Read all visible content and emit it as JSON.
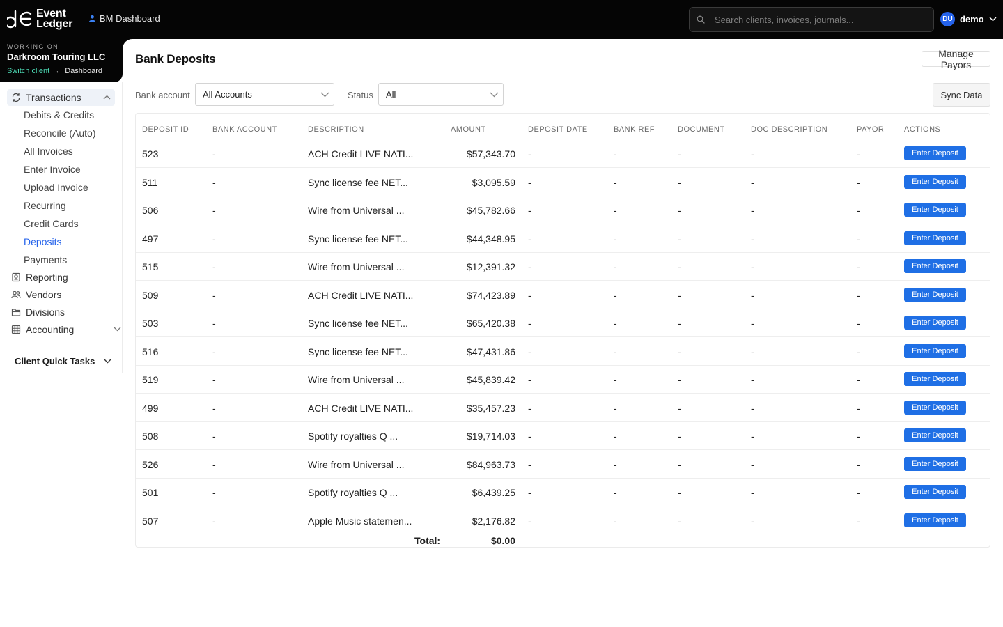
{
  "topbar": {
    "logo_line1": "Event",
    "logo_line2": "Ledger",
    "dashboard_link": "BM Dashboard",
    "search_placeholder": "Search clients, invoices, journals...",
    "user_initials": "DU",
    "user_name": "demo"
  },
  "client": {
    "working_on_label": "WORKING ON",
    "name": "Darkroom Touring LLC",
    "switch_label": "Switch client",
    "dashboard_label": "← Dashboard"
  },
  "sidebar": {
    "transactions_label": "Transactions",
    "transaction_items": [
      "Debits & Credits",
      "Reconcile (Auto)",
      "All Invoices",
      "Enter Invoice",
      "Upload Invoice",
      "Recurring",
      "Credit Cards",
      "Deposits",
      "Payments"
    ],
    "active_item": "Deposits",
    "reporting_label": "Reporting",
    "vendors_label": "Vendors",
    "divisions_label": "Divisions",
    "accounting_label": "Accounting",
    "quick_tasks_label": "Client Quick Tasks"
  },
  "main": {
    "title": "Bank Deposits",
    "manage_payors_label": "Manage Payors",
    "sync_label": "Sync Data",
    "bank_account_label": "Bank account",
    "bank_account_value": "All Accounts",
    "status_label": "Status",
    "status_value": "All"
  },
  "table": {
    "columns": [
      "DEPOSIT ID",
      "BANK ACCOUNT",
      "DESCRIPTION",
      "AMOUNT",
      "DEPOSIT DATE",
      "BANK REF",
      "DOCUMENT",
      "DOC DESCRIPTION",
      "PAYOR",
      "ACTIONS"
    ],
    "action_label": "Enter Deposit",
    "rows": [
      {
        "id": "523",
        "bank_account": "-",
        "description": "ACH Credit LIVE NATI...",
        "amount": "$57,343.70",
        "deposit_date": "-",
        "bank_ref": "-",
        "document": "-",
        "doc_description": "-",
        "payor": "-"
      },
      {
        "id": "511",
        "bank_account": "-",
        "description": "Sync license fee NET...",
        "amount": "$3,095.59",
        "deposit_date": "-",
        "bank_ref": "-",
        "document": "-",
        "doc_description": "-",
        "payor": "-"
      },
      {
        "id": "506",
        "bank_account": "-",
        "description": "Wire from Universal ...",
        "amount": "$45,782.66",
        "deposit_date": "-",
        "bank_ref": "-",
        "document": "-",
        "doc_description": "-",
        "payor": "-"
      },
      {
        "id": "497",
        "bank_account": "-",
        "description": "Sync license fee NET...",
        "amount": "$44,348.95",
        "deposit_date": "-",
        "bank_ref": "-",
        "document": "-",
        "doc_description": "-",
        "payor": "-"
      },
      {
        "id": "515",
        "bank_account": "-",
        "description": "Wire from Universal ...",
        "amount": "$12,391.32",
        "deposit_date": "-",
        "bank_ref": "-",
        "document": "-",
        "doc_description": "-",
        "payor": "-"
      },
      {
        "id": "509",
        "bank_account": "-",
        "description": "ACH Credit LIVE NATI...",
        "amount": "$74,423.89",
        "deposit_date": "-",
        "bank_ref": "-",
        "document": "-",
        "doc_description": "-",
        "payor": "-"
      },
      {
        "id": "503",
        "bank_account": "-",
        "description": "Sync license fee NET...",
        "amount": "$65,420.38",
        "deposit_date": "-",
        "bank_ref": "-",
        "document": "-",
        "doc_description": "-",
        "payor": "-"
      },
      {
        "id": "516",
        "bank_account": "-",
        "description": "Sync license fee NET...",
        "amount": "$47,431.86",
        "deposit_date": "-",
        "bank_ref": "-",
        "document": "-",
        "doc_description": "-",
        "payor": "-"
      },
      {
        "id": "519",
        "bank_account": "-",
        "description": "Wire from Universal ...",
        "amount": "$45,839.42",
        "deposit_date": "-",
        "bank_ref": "-",
        "document": "-",
        "doc_description": "-",
        "payor": "-"
      },
      {
        "id": "499",
        "bank_account": "-",
        "description": "ACH Credit LIVE NATI...",
        "amount": "$35,457.23",
        "deposit_date": "-",
        "bank_ref": "-",
        "document": "-",
        "doc_description": "-",
        "payor": "-"
      },
      {
        "id": "508",
        "bank_account": "-",
        "description": "Spotify royalties Q ...",
        "amount": "$19,714.03",
        "deposit_date": "-",
        "bank_ref": "-",
        "document": "-",
        "doc_description": "-",
        "payor": "-"
      },
      {
        "id": "526",
        "bank_account": "-",
        "description": "Wire from Universal ...",
        "amount": "$84,963.73",
        "deposit_date": "-",
        "bank_ref": "-",
        "document": "-",
        "doc_description": "-",
        "payor": "-"
      },
      {
        "id": "501",
        "bank_account": "-",
        "description": "Spotify royalties Q ...",
        "amount": "$6,439.25",
        "deposit_date": "-",
        "bank_ref": "-",
        "document": "-",
        "doc_description": "-",
        "payor": "-"
      },
      {
        "id": "507",
        "bank_account": "-",
        "description": "Apple Music statemen...",
        "amount": "$2,176.82",
        "deposit_date": "-",
        "bank_ref": "-",
        "document": "-",
        "doc_description": "-",
        "payor": "-"
      }
    ],
    "total_label": "Total:",
    "total_value": "$0.00"
  },
  "colors": {
    "topbar_bg": "#050505",
    "accent_blue": "#2563eb",
    "button_blue": "#1f6fe5",
    "switch_client_green": "#4ddbb5"
  },
  "icons": [
    "logo-mark-icon",
    "person-icon",
    "search-icon",
    "chevron-down-icon",
    "transactions-icon",
    "reporting-icon",
    "vendors-icon",
    "divisions-icon",
    "accounting-icon"
  ]
}
